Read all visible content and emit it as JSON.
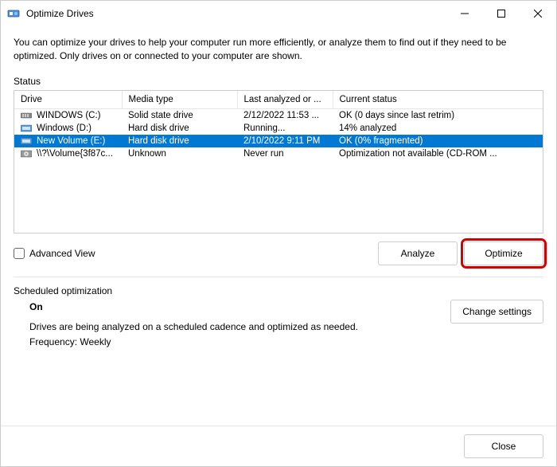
{
  "window": {
    "title": "Optimize Drives"
  },
  "description": "You can optimize your drives to help your computer run more efficiently, or analyze them to find out if they need to be optimized. Only drives on or connected to your computer are shown.",
  "status_label": "Status",
  "columns": {
    "drive": "Drive",
    "media": "Media type",
    "last": "Last analyzed or ...",
    "status": "Current status"
  },
  "drives": [
    {
      "name": "WINDOWS (C:)",
      "media": "Solid state drive",
      "last": "2/12/2022 11:53 ...",
      "status": "OK (0 days since last retrim)",
      "icon": "ssd",
      "selected": false
    },
    {
      "name": "Windows (D:)",
      "media": "Hard disk drive",
      "last": "Running...",
      "status": "14% analyzed",
      "icon": "hdd",
      "selected": false
    },
    {
      "name": "New Volume (E:)",
      "media": "Hard disk drive",
      "last": "2/10/2022 9:11 PM",
      "status": "OK (0% fragmented)",
      "icon": "hdd",
      "selected": true
    },
    {
      "name": "\\\\?\\Volume{3f87c...",
      "media": "Unknown",
      "last": "Never run",
      "status": "Optimization not available (CD-ROM ...",
      "icon": "cd",
      "selected": false
    }
  ],
  "advanced_view": "Advanced View",
  "buttons": {
    "analyze": "Analyze",
    "optimize": "Optimize",
    "change_settings": "Change settings",
    "close": "Close"
  },
  "schedule": {
    "label": "Scheduled optimization",
    "on": "On",
    "desc": "Drives are being analyzed on a scheduled cadence and optimized as needed.",
    "frequency": "Frequency: Weekly"
  }
}
